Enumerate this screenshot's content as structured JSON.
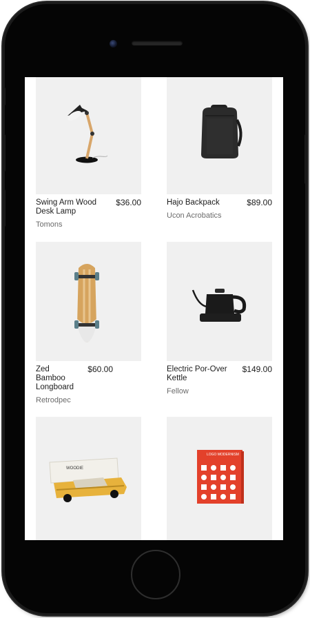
{
  "products": [
    {
      "name": "Swing Arm Wood Desk Lamp",
      "price": "$36.00",
      "brand": "Tomons",
      "image": "desk-lamp"
    },
    {
      "name": "Hajo Backpack",
      "price": "$89.00",
      "brand": "Ucon Acrobatics",
      "image": "backpack"
    },
    {
      "name": "Zed Bamboo Longboard",
      "price": "$60.00",
      "brand": "Retrodpec",
      "image": "longboard"
    },
    {
      "name": "Electric Por-Over Kettle",
      "price": "$149.00",
      "brand": "Fellow",
      "image": "kettle"
    },
    {
      "name": "",
      "price": "",
      "brand": "",
      "image": "toy-car",
      "package_label": "WOODIE"
    },
    {
      "name": "",
      "price": "",
      "brand": "",
      "image": "logo-book",
      "cover_title": "LOGO MODERNISM"
    }
  ],
  "colors": {
    "card_bg": "#f0f0f0",
    "text": "#1c1c1c",
    "brand_text": "#6a6a6a",
    "book_red": "#e3412b",
    "phone_body": "#050505"
  }
}
